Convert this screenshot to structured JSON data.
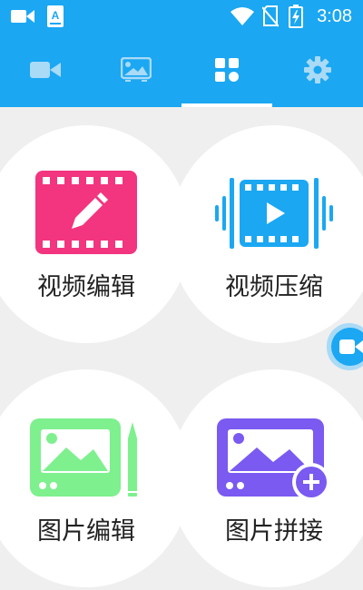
{
  "status_bar": {
    "time": "3:08",
    "left_icons": [
      "video-camera-icon",
      "keyboard-a-icon"
    ],
    "right_icons": [
      "wifi-icon",
      "no-sim-icon",
      "battery-charging-icon"
    ]
  },
  "tabs": [
    {
      "icon": "video-camera-icon",
      "selected": false
    },
    {
      "icon": "image-icon",
      "selected": false
    },
    {
      "icon": "grid-apps-icon",
      "selected": true
    },
    {
      "icon": "gear-icon",
      "selected": false
    }
  ],
  "cards": [
    {
      "label": "视频编辑",
      "icon": "film-edit-icon",
      "color": "#f2357e"
    },
    {
      "label": "视频压缩",
      "icon": "film-compress-icon",
      "color": "#1ba7f2"
    },
    {
      "label": "图片编辑",
      "icon": "image-edit-icon",
      "color": "#7ef08e"
    },
    {
      "label": "图片拼接",
      "icon": "image-join-icon",
      "color": "#7a5af0"
    }
  ],
  "floating_button": {
    "icon": "video-camera-icon"
  },
  "colors": {
    "primary": "#1ba7f2",
    "background": "#efefef",
    "card": "#ffffff",
    "text": "#222222"
  }
}
